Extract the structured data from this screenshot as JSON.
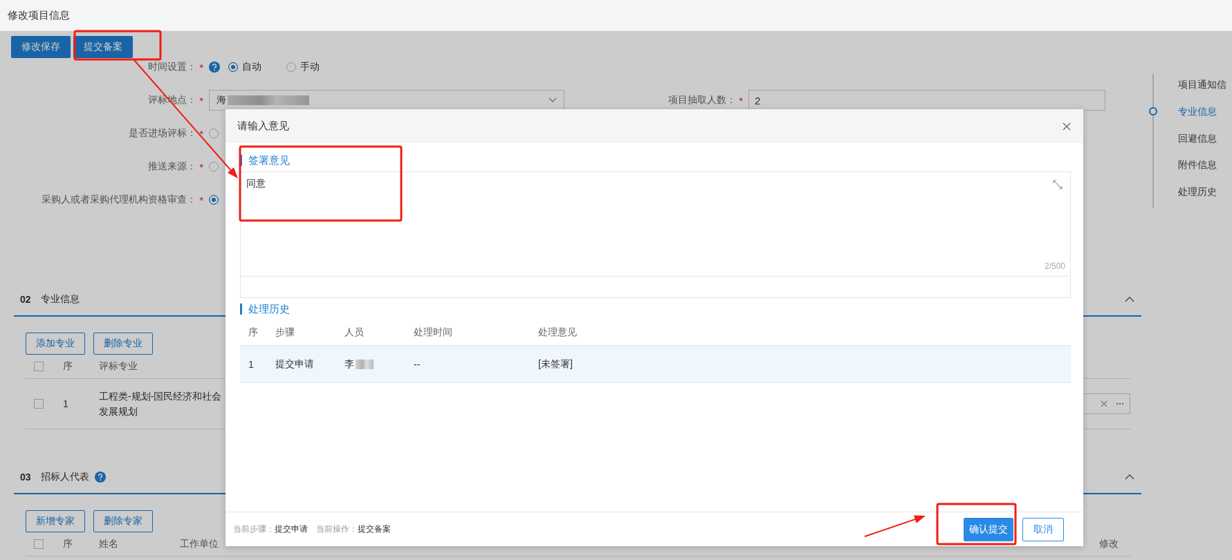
{
  "page_title": "修改项目信息",
  "toolbar": [
    {
      "label": "修改保存"
    },
    {
      "label": "提交备案"
    }
  ],
  "form": {
    "rows": [
      {
        "label": "时间设置：",
        "required_mark": "*",
        "kind": "radio",
        "help": true,
        "options": [
          {
            "label": "自动",
            "selected": true
          },
          {
            "label": "手动",
            "selected": false
          }
        ]
      },
      {
        "label": "评标地点：",
        "required_mark": "*",
        "kind": "select",
        "value": "海",
        "redacted": true,
        "side": {
          "label": "项目抽取人数：",
          "required_mark": "*",
          "value": "2"
        }
      },
      {
        "label": "是否进场评标：",
        "required_mark": "*",
        "kind": "radio",
        "options": [
          {
            "selected": false
          }
        ]
      },
      {
        "label": "推送来源：",
        "required_mark": "*",
        "kind": "radio",
        "options": [
          {
            "selected": false
          }
        ]
      },
      {
        "label": "采购人或者采购代理机构资格审查：",
        "required_mark": "*",
        "kind": "radio",
        "options": [
          {
            "selected": true
          }
        ]
      }
    ]
  },
  "sections": [
    {
      "number": "02",
      "title": "专业信息",
      "buttons": [
        "添加专业",
        "删除专业"
      ],
      "columns": [
        "序",
        "评标专业"
      ],
      "header_checked": false,
      "rows": [
        {
          "checked": false,
          "cells": [
            "1",
            "工程类-规划-国民经济和社会发展规划"
          ],
          "field": true
        }
      ]
    },
    {
      "number": "03",
      "title": "招标人代表",
      "help": true,
      "buttons": [
        "新增专家",
        "删除专家"
      ],
      "columns": [
        "序",
        "姓名",
        "工作单位"
      ],
      "last_column": "修改",
      "header_checked": false
    }
  ],
  "nav": [
    {
      "label": "项目通知信",
      "selected": false
    },
    {
      "label": "专业信息",
      "selected": true
    },
    {
      "label": "回避信息",
      "selected": false
    },
    {
      "label": "附件信息",
      "selected": false
    },
    {
      "label": "处理历史",
      "selected": false
    }
  ],
  "dialog": {
    "title": "请输入意见",
    "opinion": {
      "heading": "签署意见",
      "value": "同意",
      "counter": "2/500"
    },
    "history": {
      "heading": "处理历史",
      "columns": [
        "序",
        "步骤",
        "人员",
        "处理时间",
        "处理意见"
      ],
      "rows": [
        {
          "selected": true,
          "cells": [
            "1",
            "提交申请",
            "李",
            "--",
            "[未签署]"
          ],
          "redacted": true
        }
      ]
    },
    "status": [
      {
        "label": "当前步骤：",
        "value": "提交申请"
      },
      {
        "label": "当前操作：",
        "value": "提交备案"
      }
    ],
    "buttons": [
      {
        "label": "确认提交",
        "kind": "primary"
      },
      {
        "label": "取消",
        "kind": "default"
      }
    ]
  },
  "annotations": [
    {
      "kind": "box"
    },
    {
      "kind": "arrow"
    },
    {
      "kind": "box"
    },
    {
      "kind": "box"
    },
    {
      "kind": "arrow"
    }
  ]
}
